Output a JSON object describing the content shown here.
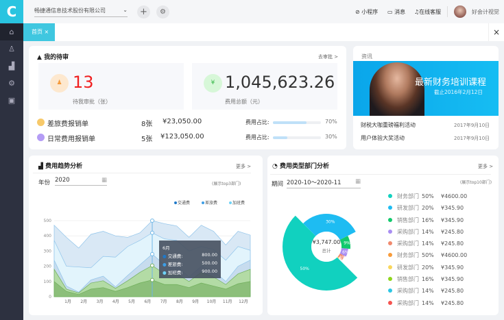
{
  "header": {
    "company": "畅捷通信息技术股份有限公司",
    "links": [
      "小程序",
      "消息",
      "在线客服"
    ],
    "user": "好会计视觉"
  },
  "tabs": [
    {
      "label": "首页"
    }
  ],
  "sidebar": {
    "icons": [
      "home-icon",
      "people-icon",
      "chart-icon",
      "gear-icon",
      "briefcase-icon"
    ]
  },
  "pending": {
    "title": "我的待审",
    "link": "去审批 >",
    "count": "13",
    "count_label": "待我审批（张）",
    "total": "1,045,623.26",
    "total_label": "费用总额（元）",
    "rows": [
      {
        "name": "差旅费报销单",
        "count": "8张",
        "amount": "¥23,050.00",
        "ratio_label": "费用占比:",
        "ratio": 70,
        "ratio_text": "70%",
        "color": "#f7c96a"
      },
      {
        "name": "日常费用报销单",
        "count": "5张",
        "amount": "¥123,050.00",
        "ratio_label": "费用占比:",
        "ratio": 30,
        "ratio_text": "30%",
        "color": "#b49cf5"
      }
    ]
  },
  "news": {
    "title": "资讯",
    "banner_title": "最新财务培训课程",
    "banner_sub": "截止2016年2月12日",
    "items": [
      {
        "title": "财税大咖重磅福利活动",
        "date": "2017年9月10日"
      },
      {
        "title": "用户体验大奖活动",
        "date": "2017年9月10日"
      }
    ]
  },
  "trend": {
    "title": "费用趋势分析",
    "more": "更多 >",
    "year_label": "年份",
    "year": "2020",
    "note": "(展示top3部门)",
    "tooltip": {
      "title": "6月",
      "rows": [
        {
          "name": "交通费:",
          "value": "800.00"
        },
        {
          "name": "差旅费:",
          "value": "500.00"
        },
        {
          "name": "加班费:",
          "value": "900.00"
        }
      ]
    }
  },
  "dept": {
    "title": "费用类型部门分析",
    "more": "更多 >",
    "period_label": "期间",
    "period": "2020-10～2020-11",
    "note": "(展示top10部门)",
    "center_value": "¥3,747.00",
    "center_label": "总计"
  },
  "chart_data": [
    {
      "type": "area",
      "stacked": true,
      "x": [
        "1月",
        "2月",
        "3月",
        "4月",
        "5月",
        "6月",
        "7月",
        "8月",
        "9月",
        "10月",
        "11月",
        "12月"
      ],
      "ylim": [
        0,
        500
      ],
      "yticks": [
        0,
        100,
        200,
        300,
        400,
        500
      ],
      "legend": [
        "交通费",
        "差旅费",
        "加班费"
      ],
      "legend_placement": "top-right",
      "grid": true,
      "series": [
        {
          "values": [
            100,
            35,
            15,
            50,
            60,
            35,
            60,
            90,
            110,
            80,
            80,
            60,
            90,
            70,
            50,
            85,
            100
          ],
          "color": "#8cbf7a"
        },
        {
          "values": [
            180,
            50,
            25,
            90,
            105,
            55,
            105,
            160,
            205,
            150,
            150,
            100,
            160,
            130,
            80,
            150,
            180
          ],
          "color": "#b3dba5"
        },
        {
          "values": [
            240,
            70,
            30,
            110,
            135,
            65,
            140,
            210,
            280,
            210,
            200,
            130,
            200,
            170,
            100,
            200,
            240
          ],
          "color": "#c7dcee"
        },
        {
          "values": [
            370,
            200,
            195,
            190,
            265,
            260,
            330,
            370,
            420,
            380,
            370,
            300,
            330,
            310,
            240,
            330,
            305
          ],
          "color": "#e2f4fc"
        },
        {
          "values": [
            470,
            390,
            320,
            410,
            430,
            400,
            390,
            420,
            500,
            480,
            465,
            390,
            470,
            430,
            340,
            430,
            405
          ],
          "color": "#d9e8f5"
        }
      ]
    },
    {
      "type": "pie",
      "rose": true,
      "slices": [
        {
          "label": "30%",
          "value": 30,
          "color": "#1ebcf2"
        },
        {
          "label": "9%",
          "value": 9,
          "color": "#12c96d"
        },
        {
          "label": "6%",
          "value": 6,
          "color": "#a98ef2"
        },
        {
          "label": "4%",
          "value": 4,
          "color": "#f08a6e"
        },
        {
          "label": "1%",
          "value": 1,
          "color": "#f9d65c"
        },
        {
          "label": "50%",
          "value": 50,
          "color": "#11d1bf"
        }
      ],
      "legend": [
        {
          "name": "财务部门",
          "pct": "50%",
          "amount": "¥4600.00",
          "color": "#11d1bf"
        },
        {
          "name": "研发部门",
          "pct": "20%",
          "amount": "¥345.90",
          "color": "#1ebcf2"
        },
        {
          "name": "销售部门",
          "pct": "16%",
          "amount": "¥345.90",
          "color": "#12c96d"
        },
        {
          "name": "采购部门",
          "pct": "14%",
          "amount": "¥245.80",
          "color": "#a98ef2"
        },
        {
          "name": "采购部门",
          "pct": "14%",
          "amount": "¥245.80",
          "color": "#f08a6e"
        },
        {
          "name": "财务部门",
          "pct": "50%",
          "amount": "¥4600.00",
          "color": "#f89b3a"
        },
        {
          "name": "研发部门",
          "pct": "20%",
          "amount": "¥345.90",
          "color": "#f9d65c"
        },
        {
          "name": "销售部门",
          "pct": "16%",
          "amount": "¥345.90",
          "color": "#8ed61c"
        },
        {
          "name": "采购部门",
          "pct": "14%",
          "amount": "¥245.80",
          "color": "#2ec6e4"
        },
        {
          "name": "采购部门",
          "pct": "14%",
          "amount": "¥245.80",
          "color": "#f5534f"
        }
      ]
    }
  ]
}
